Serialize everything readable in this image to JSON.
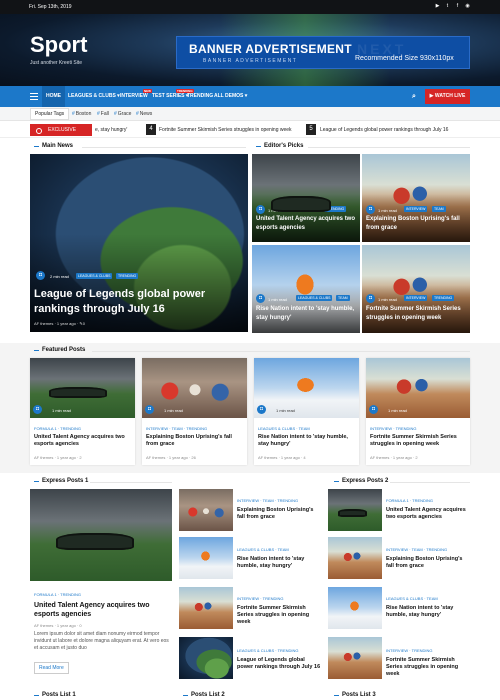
{
  "topbar": {
    "date": "Fri. Sep 13th, 2019",
    "social_icons": [
      "youtube-icon",
      "twitter-icon",
      "facebook-icon",
      "rss-icon"
    ]
  },
  "header": {
    "logo": "Sport",
    "tagline": "Just another Kreeti Site"
  },
  "banner": {
    "title": "BANNER ADVERTISEMENT",
    "subtitle": "BANNER ADVERTISEMENT",
    "size": "Recommended Size 930x110px"
  },
  "nav": {
    "items": [
      "HOME",
      "LEAGUES & CLUBS",
      "INTERVIEW",
      "TEST SERIES",
      "TRENDING",
      "ALL DEMOS"
    ],
    "badges": {
      "interview": "NEW",
      "test_series": "TRENDING"
    },
    "live": "WATCH LIVE"
  },
  "popular_tags": {
    "label": "Popular Tags",
    "tags": [
      "Boston",
      "Fall",
      "Grace",
      "News"
    ]
  },
  "ticker": {
    "label": "EXCLUSIVE",
    "items": [
      {
        "num": "",
        "text": "e, stay hungry'"
      },
      {
        "num": "4",
        "text": "Fortnite Summer Skirmish Series struggles in opening week"
      },
      {
        "num": "5",
        "text": "League of Legends global power rankings through July 16"
      }
    ]
  },
  "main_news": {
    "heading": "Main News",
    "read": "2 min read",
    "cats": [
      "LEAGUES & CLUBS",
      "TRENDING"
    ],
    "title": "League of Legends global power rankings through July 16",
    "author": "AF themes",
    "ago": "1 year ago",
    "comments": "0"
  },
  "editors_picks": {
    "heading": "Editor's Picks",
    "items": [
      {
        "read": "1 min read",
        "cats": [
          "FORMULA 1",
          "TRENDING"
        ],
        "title": "United Talent Agency acquires two esports agencies"
      },
      {
        "read": "1 min read",
        "cats": [
          "INTERVIEW",
          "TEAM"
        ],
        "title": "Explaining Boston Uprising's fall from grace"
      },
      {
        "read": "1 min read",
        "cats": [
          "LEAGUES & CLUBS",
          "TEAM"
        ],
        "title": "Rise Nation intent to 'stay humble, stay hungry'"
      },
      {
        "read": "1 min read",
        "cats": [
          "INTERVIEW",
          "TRENDING"
        ],
        "title": "Fortnite Summer Skirmish Series struggles in opening week"
      }
    ]
  },
  "featured_posts": {
    "heading": "Featured Posts",
    "items": [
      {
        "read": "1 min read",
        "cats": "FORMULA 1 · TRENDING",
        "title": "United Talent Agency acquires two esports agencies",
        "author": "AF themes",
        "ago": "1 year ago",
        "comments": "2"
      },
      {
        "read": "1 min read",
        "cats": "INTERVIEW · TEAM · TRENDING",
        "title": "Explaining Boston Uprising's fall from grace",
        "author": "AF themes",
        "ago": "1 year ago",
        "comments": "26"
      },
      {
        "read": "1 min read",
        "cats": "LEAGUES & CLUBS · TEAM",
        "title": "Rise Nation intent to 'stay humble, stay hungry'",
        "author": "AF themes",
        "ago": "1 year ago",
        "comments": "4"
      },
      {
        "read": "1 min read",
        "cats": "INTERVIEW · TRENDING",
        "title": "Fortnite Summer Skirmish Series struggles in opening week",
        "author": "AF themes",
        "ago": "1 year ago",
        "comments": "2"
      }
    ]
  },
  "express_posts_1": {
    "heading": "Express Posts 1",
    "main": {
      "cats": "FORMULA 1 · TRENDING",
      "title": "United Talent Agency acquires two esports agencies",
      "author": "AF themes",
      "ago": "1 year ago",
      "comments": "0",
      "excerpt": "Lorem ipsum dolor sit amet diam nonumy eirmod tempor invidunt ut labore et dolore magna aliquyam erat. At vero eos et accusam et justo duo",
      "read_more": "Read More"
    },
    "list": [
      {
        "cats": "INTERVIEW · TEAM · TRENDING",
        "title": "Explaining Boston Uprising's fall from grace"
      },
      {
        "cats": "LEAGUES & CLUBS · TEAM",
        "title": "Rise Nation intent to 'stay humble, stay hungry'"
      },
      {
        "cats": "INTERVIEW · TRENDING",
        "title": "Fortnite Summer Skirmish Series struggles in opening week"
      },
      {
        "cats": "LEAGUES & CLUBS · TRENDING",
        "title": "League of Legends global power rankings through July 16"
      }
    ]
  },
  "express_posts_2": {
    "heading": "Express Posts 2",
    "list": [
      {
        "cats": "FORMULA 1 · TRENDING",
        "title": "United Talent Agency acquires two esports agencies"
      },
      {
        "cats": "INTERVIEW · TEAM · TRENDING",
        "title": "Explaining Boston Uprising's fall from grace"
      },
      {
        "cats": "LEAGUES & CLUBS · TEAM",
        "title": "Rise Nation intent to 'stay humble, stay hungry'"
      },
      {
        "cats": "INTERVIEW · TRENDING",
        "title": "Fortnite Summer Skirmish Series struggles in opening week"
      }
    ]
  },
  "posts_lists": [
    "Posts List 1",
    "Posts List 2",
    "Posts List 3"
  ]
}
